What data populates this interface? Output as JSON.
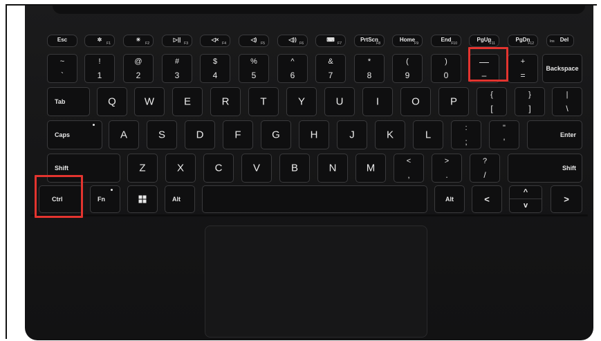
{
  "keyboard": {
    "function_row": [
      {
        "label": "Esc",
        "sub": "",
        "icon": ""
      },
      {
        "label": "✲",
        "sub": "F1",
        "icon": "brightness-down-icon"
      },
      {
        "label": "☀",
        "sub": "F2",
        "icon": "brightness-up-icon"
      },
      {
        "label": "▷||",
        "sub": "F3",
        "icon": "play-pause-icon"
      },
      {
        "label": "◁×",
        "sub": "F4",
        "icon": "mute-icon"
      },
      {
        "label": "◁)",
        "sub": "F5",
        "icon": "volume-down-icon"
      },
      {
        "label": "◁))",
        "sub": "F6",
        "icon": "volume-up-icon"
      },
      {
        "label": "⌨",
        "sub": "F7",
        "icon": "backlight-icon"
      },
      {
        "label": "PrtScn",
        "sub": "F8",
        "icon": ""
      },
      {
        "label": "Home",
        "sub": "F9",
        "icon": ""
      },
      {
        "label": "End",
        "sub": "F10",
        "icon": ""
      },
      {
        "label": "PgUp",
        "sub": "F11",
        "icon": ""
      },
      {
        "label": "PgDn",
        "sub": "F12",
        "icon": ""
      },
      {
        "label": "Del",
        "sub": "Ins",
        "icon": ""
      }
    ],
    "number_row": [
      {
        "top": "~",
        "bottom": "`"
      },
      {
        "top": "!",
        "bottom": "1"
      },
      {
        "top": "@",
        "bottom": "2"
      },
      {
        "top": "#",
        "bottom": "3"
      },
      {
        "top": "$",
        "bottom": "4"
      },
      {
        "top": "%",
        "bottom": "5"
      },
      {
        "top": "^",
        "bottom": "6"
      },
      {
        "top": "&",
        "bottom": "7"
      },
      {
        "top": "*",
        "bottom": "8"
      },
      {
        "top": "(",
        "bottom": "9"
      },
      {
        "top": ")",
        "bottom": "0"
      },
      {
        "top": "—",
        "bottom": "–"
      },
      {
        "top": "+",
        "bottom": "="
      }
    ],
    "backspace": "Backspace",
    "tab": "Tab",
    "qwerty_row": [
      "Q",
      "W",
      "E",
      "R",
      "T",
      "Y",
      "U",
      "I",
      "O",
      "P"
    ],
    "qwerty_symbols": [
      {
        "top": "{",
        "bottom": "["
      },
      {
        "top": "}",
        "bottom": "]"
      },
      {
        "top": "|",
        "bottom": "\\"
      }
    ],
    "caps": "Caps",
    "home_row": [
      "A",
      "S",
      "D",
      "F",
      "G",
      "H",
      "J",
      "K",
      "L"
    ],
    "home_symbols": [
      {
        "top": ":",
        "bottom": ";"
      },
      {
        "top": "\"",
        "bottom": "'"
      }
    ],
    "enter": "Enter",
    "shift_left": "Shift",
    "bottom_row": [
      "Z",
      "X",
      "C",
      "V",
      "B",
      "N",
      "M"
    ],
    "bottom_symbols": [
      {
        "top": "<",
        "bottom": ","
      },
      {
        "top": ">",
        "bottom": "."
      },
      {
        "top": "?",
        "bottom": "/"
      }
    ],
    "shift_right": "Shift",
    "ctrl": "Ctrl",
    "fn": "Fn",
    "alt_left": "Alt",
    "alt_right": "Alt",
    "arrow_left": "<",
    "arrow_up": "^",
    "arrow_down": "v",
    "arrow_right": ">"
  },
  "highlights": {
    "color": "#e3342f",
    "keys": [
      "minus-key",
      "ctrl-key"
    ]
  }
}
